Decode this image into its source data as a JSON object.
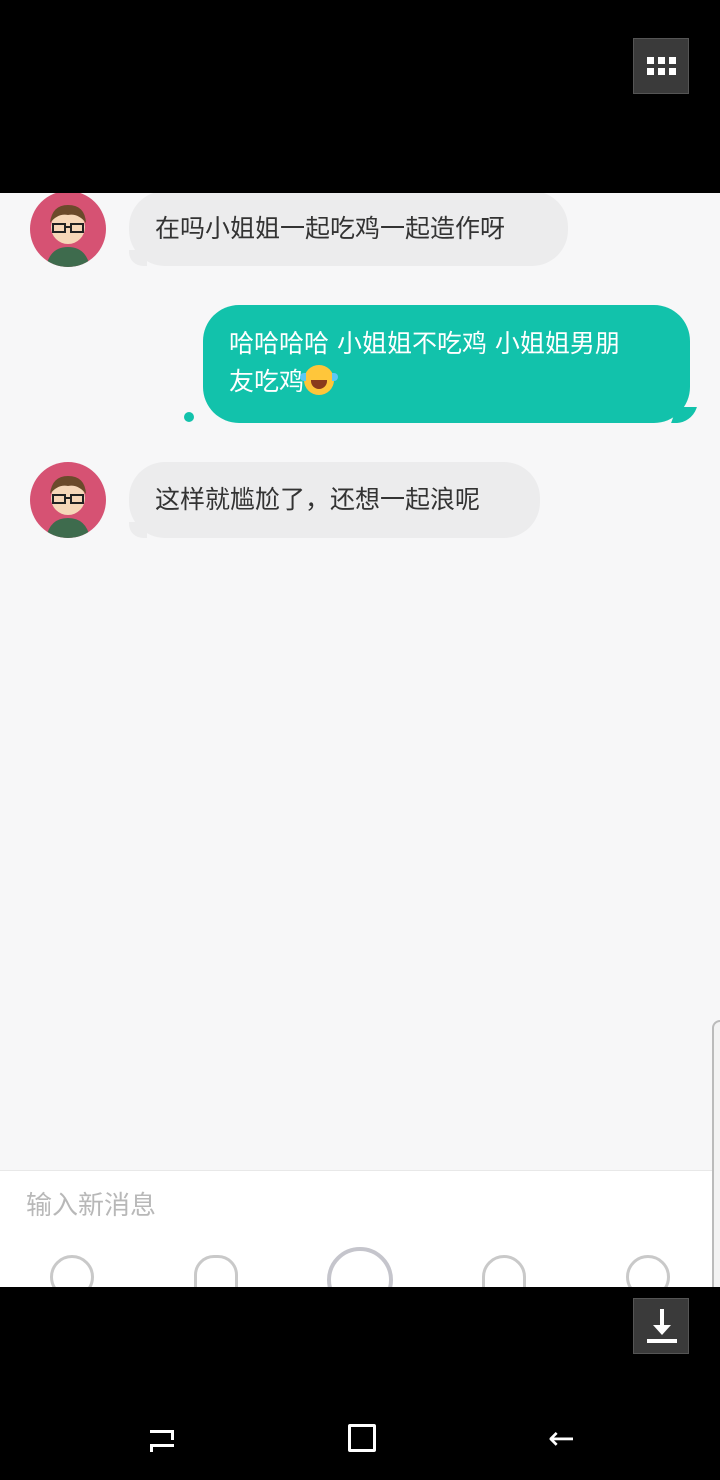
{
  "messages": [
    {
      "side": "in",
      "text": "在吗小姐姐一起吃鸡一起造作呀"
    },
    {
      "side": "out",
      "text_line1": "哈哈哈哈 小姐姐不吃鸡 小姐姐男朋",
      "text_line2": "友吃鸡",
      "emoji": "tears-of-joy-emoji"
    },
    {
      "side": "in",
      "text": "这样就尴尬了，还想一起浪呢"
    }
  ],
  "input": {
    "placeholder": "输入新消息"
  },
  "toolbar": {
    "icons": [
      "picture-icon",
      "call-icon",
      "voice-record-icon",
      "capsule-icon",
      "emoji-icon"
    ]
  },
  "colors": {
    "accent": "#12c2ab",
    "incoming_bubble": "#ececed",
    "avatar_bg": "#d65273"
  },
  "nav": {
    "back_glyph": "←"
  }
}
